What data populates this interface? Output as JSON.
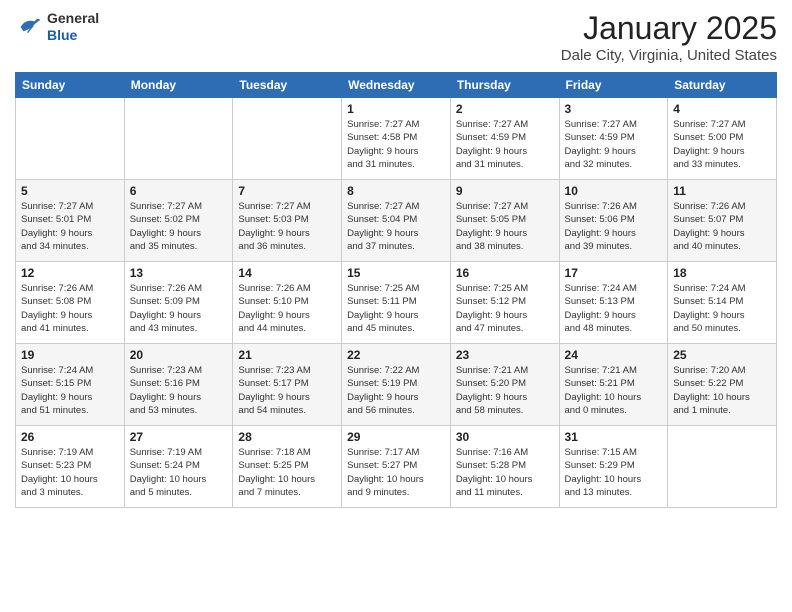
{
  "header": {
    "logo_general": "General",
    "logo_blue": "Blue",
    "month_title": "January 2025",
    "location": "Dale City, Virginia, United States"
  },
  "weekdays": [
    "Sunday",
    "Monday",
    "Tuesday",
    "Wednesday",
    "Thursday",
    "Friday",
    "Saturday"
  ],
  "weeks": [
    [
      {
        "day": "",
        "info": ""
      },
      {
        "day": "",
        "info": ""
      },
      {
        "day": "",
        "info": ""
      },
      {
        "day": "1",
        "info": "Sunrise: 7:27 AM\nSunset: 4:58 PM\nDaylight: 9 hours\nand 31 minutes."
      },
      {
        "day": "2",
        "info": "Sunrise: 7:27 AM\nSunset: 4:59 PM\nDaylight: 9 hours\nand 31 minutes."
      },
      {
        "day": "3",
        "info": "Sunrise: 7:27 AM\nSunset: 4:59 PM\nDaylight: 9 hours\nand 32 minutes."
      },
      {
        "day": "4",
        "info": "Sunrise: 7:27 AM\nSunset: 5:00 PM\nDaylight: 9 hours\nand 33 minutes."
      }
    ],
    [
      {
        "day": "5",
        "info": "Sunrise: 7:27 AM\nSunset: 5:01 PM\nDaylight: 9 hours\nand 34 minutes."
      },
      {
        "day": "6",
        "info": "Sunrise: 7:27 AM\nSunset: 5:02 PM\nDaylight: 9 hours\nand 35 minutes."
      },
      {
        "day": "7",
        "info": "Sunrise: 7:27 AM\nSunset: 5:03 PM\nDaylight: 9 hours\nand 36 minutes."
      },
      {
        "day": "8",
        "info": "Sunrise: 7:27 AM\nSunset: 5:04 PM\nDaylight: 9 hours\nand 37 minutes."
      },
      {
        "day": "9",
        "info": "Sunrise: 7:27 AM\nSunset: 5:05 PM\nDaylight: 9 hours\nand 38 minutes."
      },
      {
        "day": "10",
        "info": "Sunrise: 7:26 AM\nSunset: 5:06 PM\nDaylight: 9 hours\nand 39 minutes."
      },
      {
        "day": "11",
        "info": "Sunrise: 7:26 AM\nSunset: 5:07 PM\nDaylight: 9 hours\nand 40 minutes."
      }
    ],
    [
      {
        "day": "12",
        "info": "Sunrise: 7:26 AM\nSunset: 5:08 PM\nDaylight: 9 hours\nand 41 minutes."
      },
      {
        "day": "13",
        "info": "Sunrise: 7:26 AM\nSunset: 5:09 PM\nDaylight: 9 hours\nand 43 minutes."
      },
      {
        "day": "14",
        "info": "Sunrise: 7:26 AM\nSunset: 5:10 PM\nDaylight: 9 hours\nand 44 minutes."
      },
      {
        "day": "15",
        "info": "Sunrise: 7:25 AM\nSunset: 5:11 PM\nDaylight: 9 hours\nand 45 minutes."
      },
      {
        "day": "16",
        "info": "Sunrise: 7:25 AM\nSunset: 5:12 PM\nDaylight: 9 hours\nand 47 minutes."
      },
      {
        "day": "17",
        "info": "Sunrise: 7:24 AM\nSunset: 5:13 PM\nDaylight: 9 hours\nand 48 minutes."
      },
      {
        "day": "18",
        "info": "Sunrise: 7:24 AM\nSunset: 5:14 PM\nDaylight: 9 hours\nand 50 minutes."
      }
    ],
    [
      {
        "day": "19",
        "info": "Sunrise: 7:24 AM\nSunset: 5:15 PM\nDaylight: 9 hours\nand 51 minutes."
      },
      {
        "day": "20",
        "info": "Sunrise: 7:23 AM\nSunset: 5:16 PM\nDaylight: 9 hours\nand 53 minutes."
      },
      {
        "day": "21",
        "info": "Sunrise: 7:23 AM\nSunset: 5:17 PM\nDaylight: 9 hours\nand 54 minutes."
      },
      {
        "day": "22",
        "info": "Sunrise: 7:22 AM\nSunset: 5:19 PM\nDaylight: 9 hours\nand 56 minutes."
      },
      {
        "day": "23",
        "info": "Sunrise: 7:21 AM\nSunset: 5:20 PM\nDaylight: 9 hours\nand 58 minutes."
      },
      {
        "day": "24",
        "info": "Sunrise: 7:21 AM\nSunset: 5:21 PM\nDaylight: 10 hours\nand 0 minutes."
      },
      {
        "day": "25",
        "info": "Sunrise: 7:20 AM\nSunset: 5:22 PM\nDaylight: 10 hours\nand 1 minute."
      }
    ],
    [
      {
        "day": "26",
        "info": "Sunrise: 7:19 AM\nSunset: 5:23 PM\nDaylight: 10 hours\nand 3 minutes."
      },
      {
        "day": "27",
        "info": "Sunrise: 7:19 AM\nSunset: 5:24 PM\nDaylight: 10 hours\nand 5 minutes."
      },
      {
        "day": "28",
        "info": "Sunrise: 7:18 AM\nSunset: 5:25 PM\nDaylight: 10 hours\nand 7 minutes."
      },
      {
        "day": "29",
        "info": "Sunrise: 7:17 AM\nSunset: 5:27 PM\nDaylight: 10 hours\nand 9 minutes."
      },
      {
        "day": "30",
        "info": "Sunrise: 7:16 AM\nSunset: 5:28 PM\nDaylight: 10 hours\nand 11 minutes."
      },
      {
        "day": "31",
        "info": "Sunrise: 7:15 AM\nSunset: 5:29 PM\nDaylight: 10 hours\nand 13 minutes."
      },
      {
        "day": "",
        "info": ""
      }
    ]
  ]
}
